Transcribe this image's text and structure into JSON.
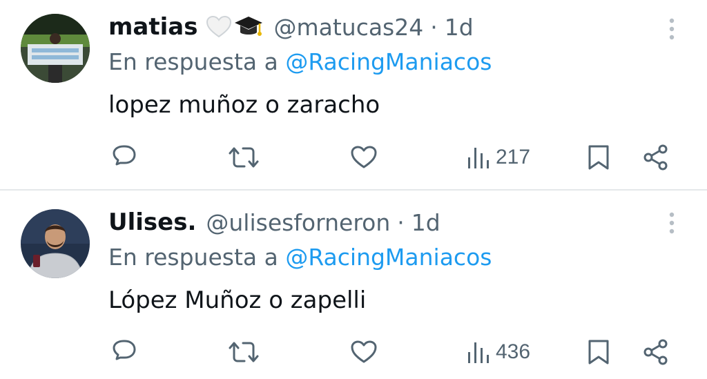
{
  "colors": {
    "text_primary": "#0f1419",
    "text_secondary": "#536471",
    "link": "#1d9bf0",
    "divider": "#e4e7ea",
    "icon": "#536471"
  },
  "tweets": [
    {
      "display_name": "matias",
      "emoji": [
        "white-heart-icon",
        "graduation-cap-icon"
      ],
      "handle": "@matucas24",
      "separator": "·",
      "time": "1d",
      "reply_prefix": "En respuesta a",
      "reply_to": "@RacingManiacos",
      "text": "lopez muñoz o zaracho",
      "views": "217",
      "icons": [
        "reply-icon",
        "retweet-icon",
        "like-icon",
        "views-icon",
        "bookmark-icon",
        "share-icon",
        "more-icon"
      ]
    },
    {
      "display_name": "Ulises.",
      "handle": "@ulisesforneron",
      "separator": "·",
      "time": "1d",
      "reply_prefix": "En respuesta a",
      "reply_to": "@RacingManiacos",
      "text": "López Muñoz o zapelli",
      "views": "436",
      "icons": [
        "reply-icon",
        "retweet-icon",
        "like-icon",
        "views-icon",
        "bookmark-icon",
        "share-icon",
        "more-icon"
      ]
    }
  ]
}
